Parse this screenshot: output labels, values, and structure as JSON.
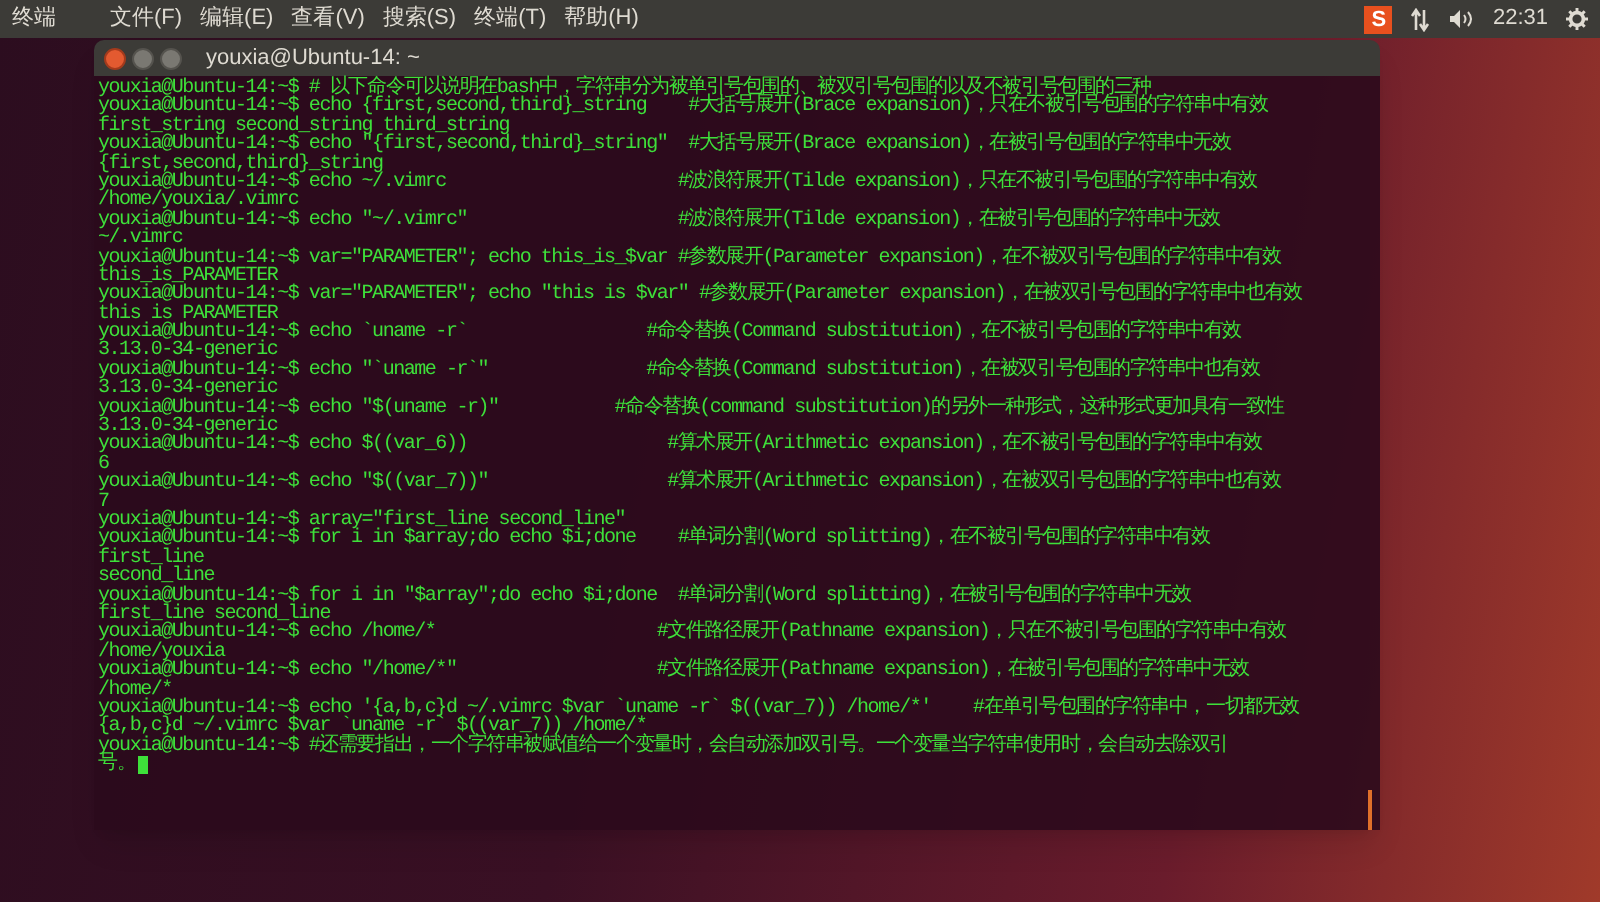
{
  "top_bar": {
    "app_name": "终端",
    "menus": [
      "文件(F)",
      "编辑(E)",
      "查看(V)",
      "搜索(S)",
      "终端(T)",
      "帮助(H)"
    ],
    "input_method": "S",
    "time": "22:31"
  },
  "window": {
    "title": "youxia@Ubuntu-14: ~"
  },
  "terminal": {
    "cursor": true,
    "lines": [
      "youxia@Ubuntu-14:~$ # 以下命令可以说明在bash中，字符串分为被单引号包围的、被双引号包围的以及不被引号包围的三种",
      "youxia@Ubuntu-14:~$ echo {first,second,third}_string    #大括号展开(Brace expansion)，只在不被引号包围的字符串中有效",
      "first_string second_string third_string",
      "youxia@Ubuntu-14:~$ echo \"{first,second,third}_string\"  #大括号展开(Brace expansion)，在被引号包围的字符串中无效",
      "{first,second,third}_string",
      "youxia@Ubuntu-14:~$ echo ~/.vimrc                      #波浪符展开(Tilde expansion)，只在不被引号包围的字符串中有效",
      "/home/youxia/.vimrc",
      "youxia@Ubuntu-14:~$ echo \"~/.vimrc\"                    #波浪符展开(Tilde expansion)，在被引号包围的字符串中无效",
      "~/.vimrc",
      "youxia@Ubuntu-14:~$ var=\"PARAMETER\"; echo this_is_$var #参数展开(Parameter expansion)，在不被双引号包围的字符串中有效",
      "this_is_PARAMETER",
      "youxia@Ubuntu-14:~$ var=\"PARAMETER\"; echo \"this is $var\" #参数展开(Parameter expansion)，在被双引号包围的字符串中也有效",
      "this is PARAMETER",
      "youxia@Ubuntu-14:~$ echo `uname -r`                 #命令替换(Command substitution)，在不被引号包围的字符串中有效",
      "3.13.0-34-generic",
      "youxia@Ubuntu-14:~$ echo \"`uname -r`\"               #命令替换(Command substitution)，在被双引号包围的字符串中也有效",
      "3.13.0-34-generic",
      "youxia@Ubuntu-14:~$ echo \"$(uname -r)\"           #命令替换(command substitution)的另外一种形式，这种形式更加具有一致性",
      "3.13.0-34-generic",
      "youxia@Ubuntu-14:~$ echo $((var_6))                   #算术展开(Arithmetic expansion)，在不被引号包围的字符串中有效",
      "6",
      "youxia@Ubuntu-14:~$ echo \"$((var_7))\"                 #算术展开(Arithmetic expansion)，在被双引号包围的字符串中也有效",
      "7",
      "youxia@Ubuntu-14:~$ array=\"first_line second_line\"",
      "youxia@Ubuntu-14:~$ for i in $array;do echo $i;done    #单词分割(Word splitting)，在不被引号包围的字符串中有效",
      "first_line",
      "second_line",
      "youxia@Ubuntu-14:~$ for i in \"$array\";do echo $i;done  #单词分割(Word splitting)，在被引号包围的字符串中无效",
      "first_line second_line",
      "youxia@Ubuntu-14:~$ echo /home/*                     #文件路径展开(Pathname expansion)，只在不被引号包围的字符串中有效",
      "/home/youxia",
      "youxia@Ubuntu-14:~$ echo \"/home/*\"                   #文件路径展开(Pathname expansion)，在被引号包围的字符串中无效",
      "/home/*",
      "youxia@Ubuntu-14:~$ echo '{a,b,c}d ~/.vimrc $var `uname -r` $((var_7)) /home/*'    #在单引号包围的字符串中，一切都无效",
      "{a,b,c}d ~/.vimrc $var `uname -r` $((var_7)) /home/*",
      "youxia@Ubuntu-14:~$ #还需要指出，一个字符串被赋值给一个变量时，会自动添加双引号。一个变量当字符串使用时，会自动去除双引",
      "号。"
    ]
  }
}
